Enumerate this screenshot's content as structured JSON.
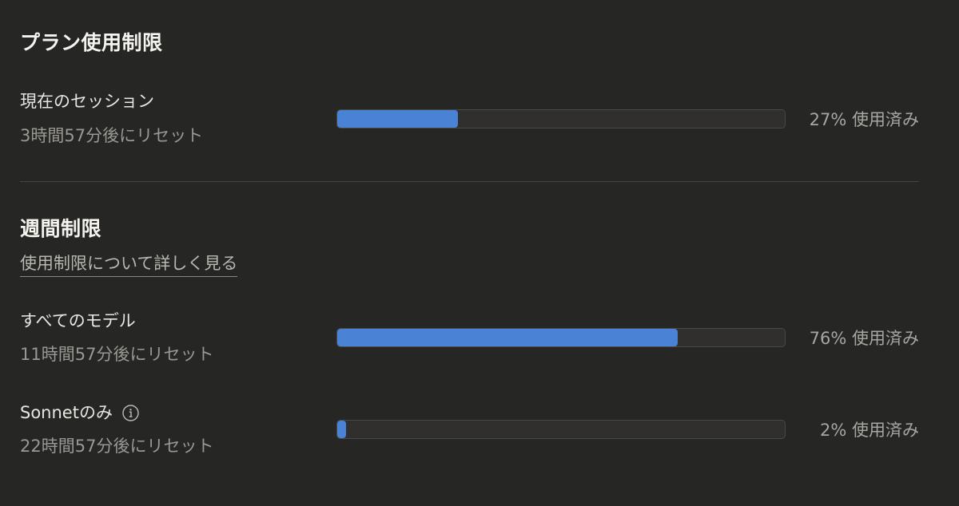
{
  "plan_limits": {
    "title": "プラン使用制限",
    "current_session": {
      "label": "現在のセッション",
      "reset_text": "3時間57分後にリセット",
      "percent": 27,
      "percent_text": "27% 使用済み"
    }
  },
  "weekly_limits": {
    "title": "週間制限",
    "learn_more_link": "使用制限について詳しく見る",
    "all_models": {
      "label": "すべてのモデル",
      "reset_text": "11時間57分後にリセット",
      "percent": 76,
      "percent_text": "76% 使用済み"
    },
    "sonnet_only": {
      "label": "Sonnetのみ",
      "info_icon": "info-icon",
      "reset_text": "22時間57分後にリセット",
      "percent": 2,
      "percent_text": "2% 使用済み"
    }
  },
  "colors": {
    "background": "#262624",
    "bar_fill": "#4a82d6",
    "bar_track": "#302f2d"
  }
}
